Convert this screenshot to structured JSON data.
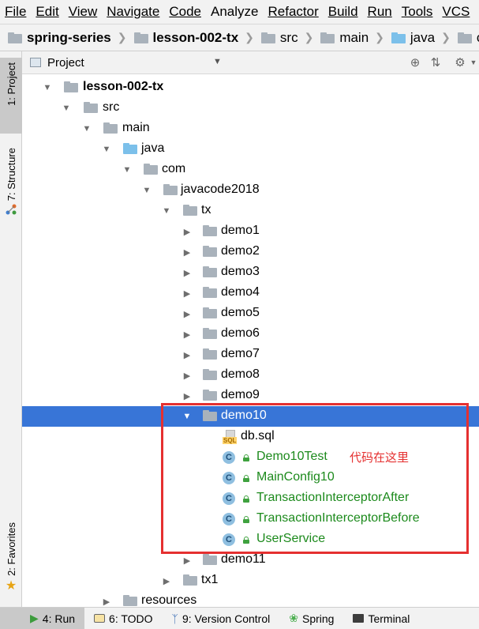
{
  "menu": [
    "File",
    "Edit",
    "View",
    "Navigate",
    "Code",
    "Analyze",
    "Refactor",
    "Build",
    "Run",
    "Tools",
    "VCS"
  ],
  "breadcrumb": [
    "spring-series",
    "lesson-002-tx",
    "src",
    "main",
    "java",
    "com"
  ],
  "left_strip": {
    "project_tab": "1: Project",
    "structure_tab": "7: Structure",
    "favorites_tab": "2: Favorites"
  },
  "project_panel": {
    "title": "Project",
    "view_icon": "target-icon",
    "collapse_icon": "collapse-icon",
    "settings_icon": "gear-icon"
  },
  "tree": {
    "root": "lesson-002-tx",
    "src": "src",
    "main": "main",
    "java": "java",
    "com": "com",
    "javacode2018": "javacode2018",
    "tx": "tx",
    "demos": [
      "demo1",
      "demo2",
      "demo3",
      "demo4",
      "demo5",
      "demo6",
      "demo7",
      "demo8",
      "demo9"
    ],
    "demo10": "demo10",
    "demo10_children": [
      "db.sql",
      "Demo10Test",
      "MainConfig10",
      "TransactionInterceptorAfter",
      "TransactionInterceptorBefore",
      "UserService"
    ],
    "demo11": "demo11",
    "tx1": "tx1",
    "resources": "resources"
  },
  "annotation": {
    "text": "代码在这里",
    "color": "#e53030"
  },
  "bottom_bar": {
    "run": "4: Run",
    "todo": "6: TODO",
    "vcs": "9: Version Control",
    "spring": "Spring",
    "terminal": "Terminal"
  },
  "colors": {
    "selection": "#3875d7",
    "class_text": "#1c8a1c",
    "folder_blue": "#7cc0ea"
  }
}
